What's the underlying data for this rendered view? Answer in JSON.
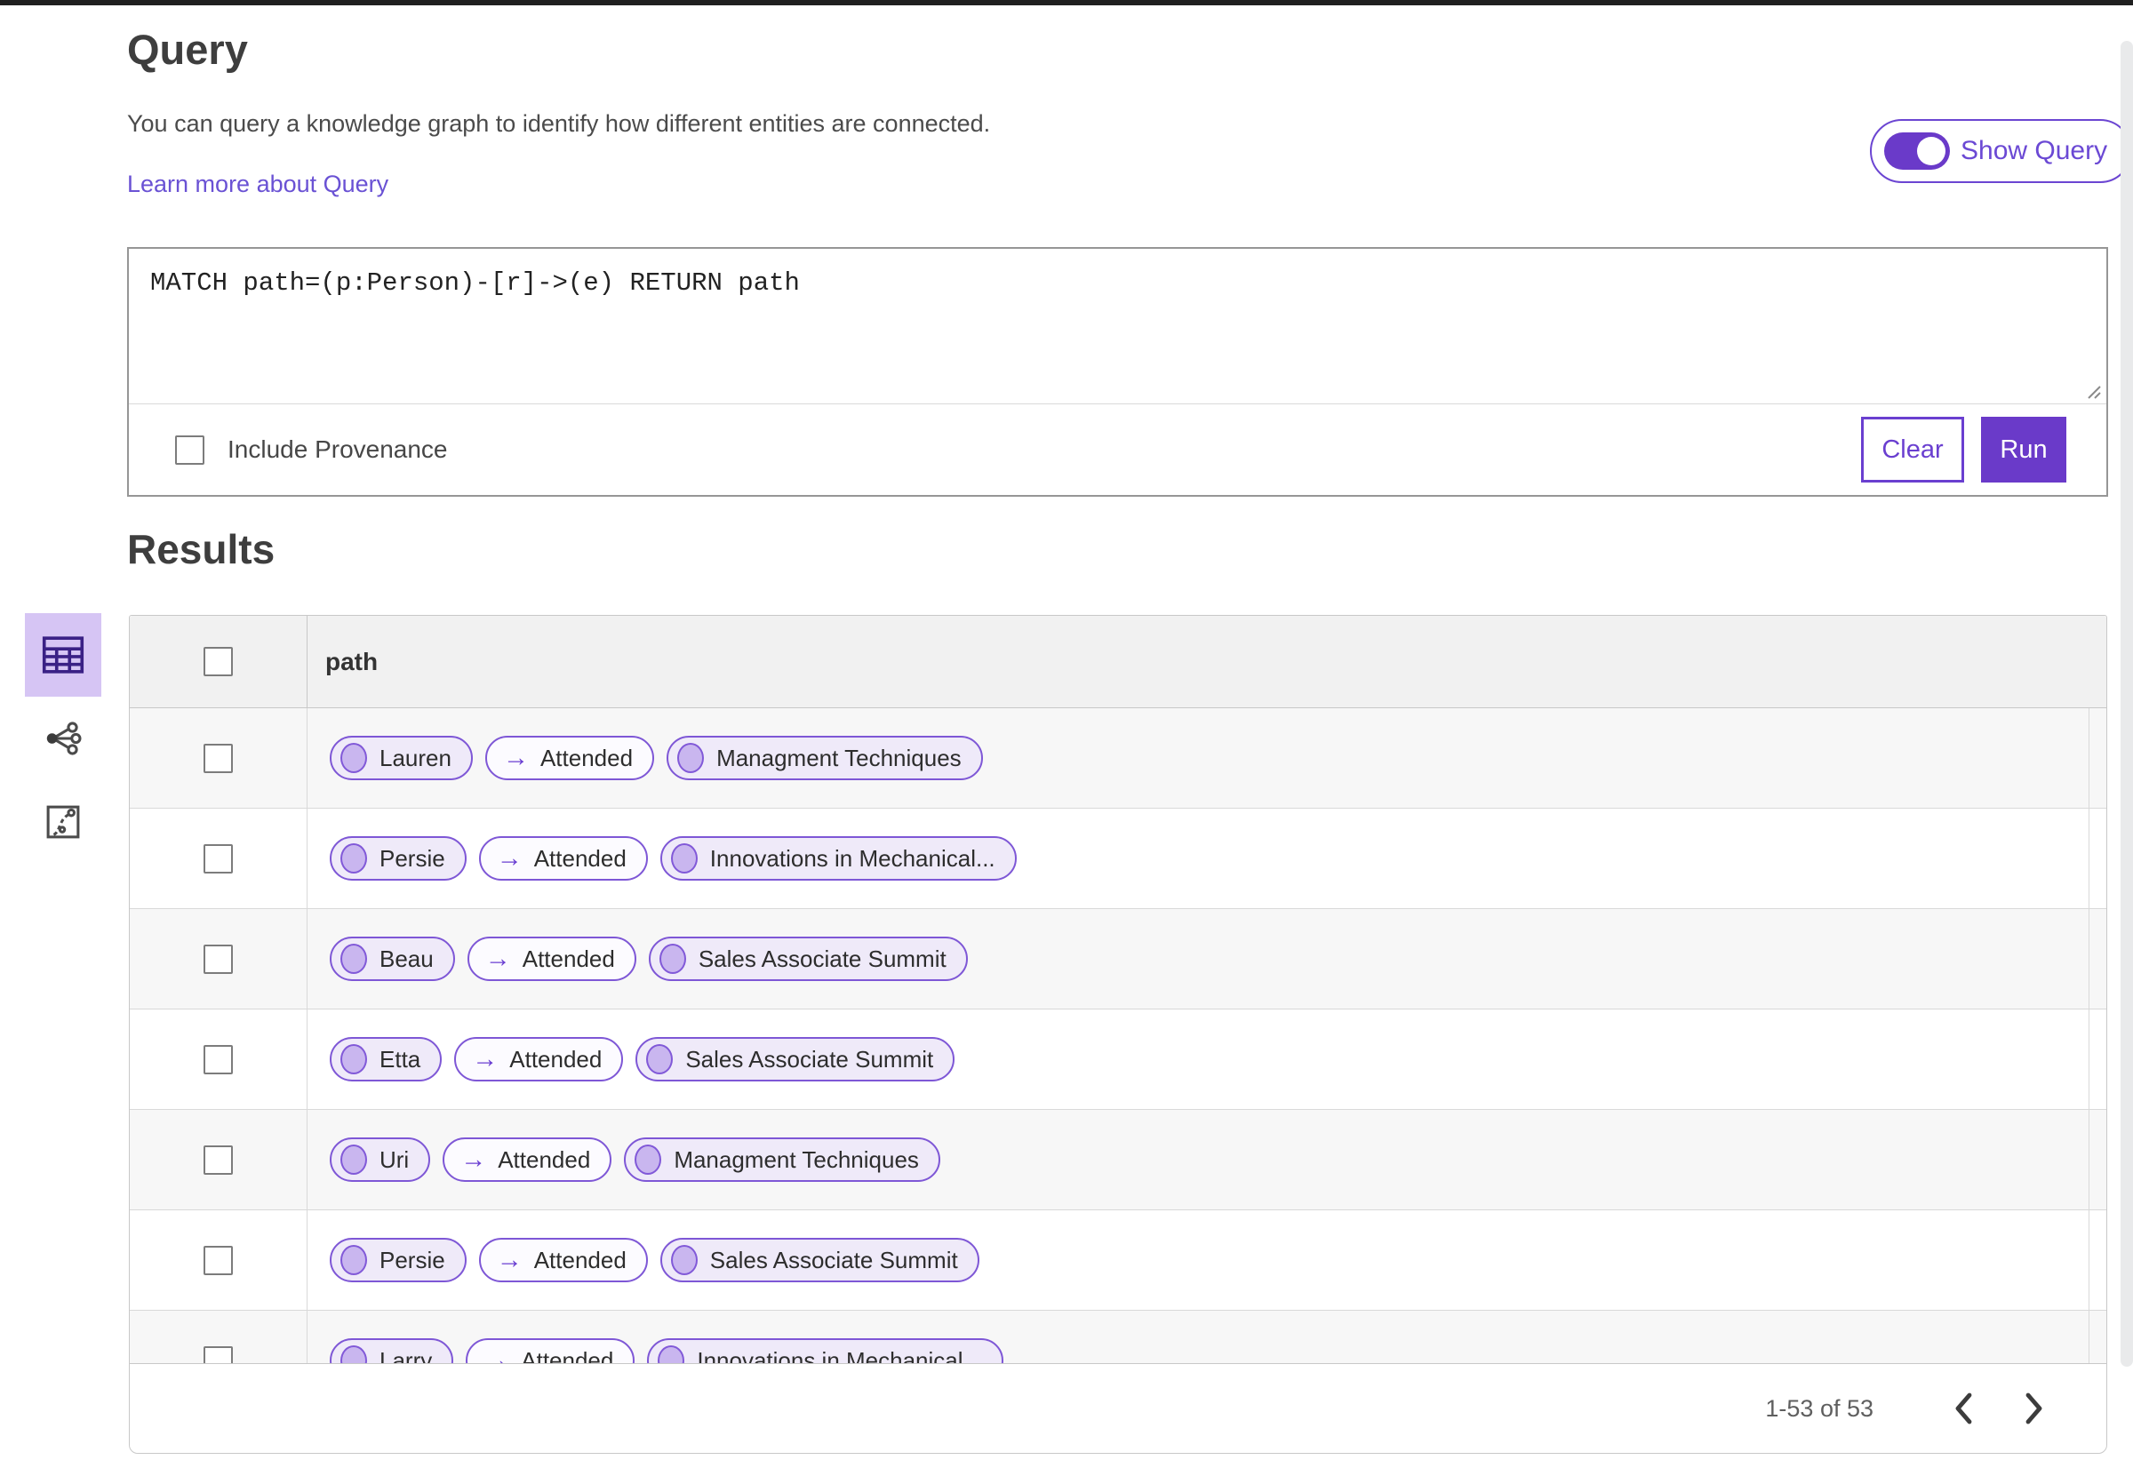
{
  "query_section": {
    "title": "Query",
    "description": "You can query a knowledge graph to identify how different entities are connected.",
    "learn_more_label": "Learn more about Query",
    "show_query_label": "Show Query",
    "show_query_toggle_state": "on",
    "query_text": "MATCH path=(p:Person)-[r]->(e) RETURN path",
    "include_provenance_label": "Include Provenance",
    "include_provenance_checked": false,
    "clear_label": "Clear",
    "run_label": "Run"
  },
  "results_section": {
    "title": "Results",
    "column_header": "path",
    "view_switcher": [
      {
        "name": "table-view",
        "icon": "table-icon",
        "selected": true
      },
      {
        "name": "link-chart-view",
        "icon": "share-network-icon",
        "selected": false
      },
      {
        "name": "chart-view",
        "icon": "line-chart-icon",
        "selected": false
      }
    ],
    "rows": [
      {
        "source": "Lauren",
        "relation": "Attended",
        "target": "Managment Techniques"
      },
      {
        "source": "Persie",
        "relation": "Attended",
        "target": "Innovations in Mechanical..."
      },
      {
        "source": "Beau",
        "relation": "Attended",
        "target": "Sales Associate Summit"
      },
      {
        "source": "Etta",
        "relation": "Attended",
        "target": "Sales Associate Summit"
      },
      {
        "source": "Uri",
        "relation": "Attended",
        "target": "Managment Techniques"
      },
      {
        "source": "Persie",
        "relation": "Attended",
        "target": "Sales Associate Summit"
      },
      {
        "source": "Larry",
        "relation": "Attended",
        "target": "Innovations in Mechanical..."
      }
    ],
    "pagination": {
      "range_label": "1-53 of 53"
    }
  },
  "glyphs": {
    "arrow_right": "→"
  },
  "colors": {
    "accent_purple": "#6a3ac9",
    "pill_border_purple": "#7e57d6",
    "pill_node_fill": "#efeaf9",
    "node_circle_fill": "#c9b6ef",
    "selected_tile_fill": "#d6c5f4",
    "header_row_fill": "#f1f1f1",
    "alt_row_fill": "#f7f7f7"
  }
}
